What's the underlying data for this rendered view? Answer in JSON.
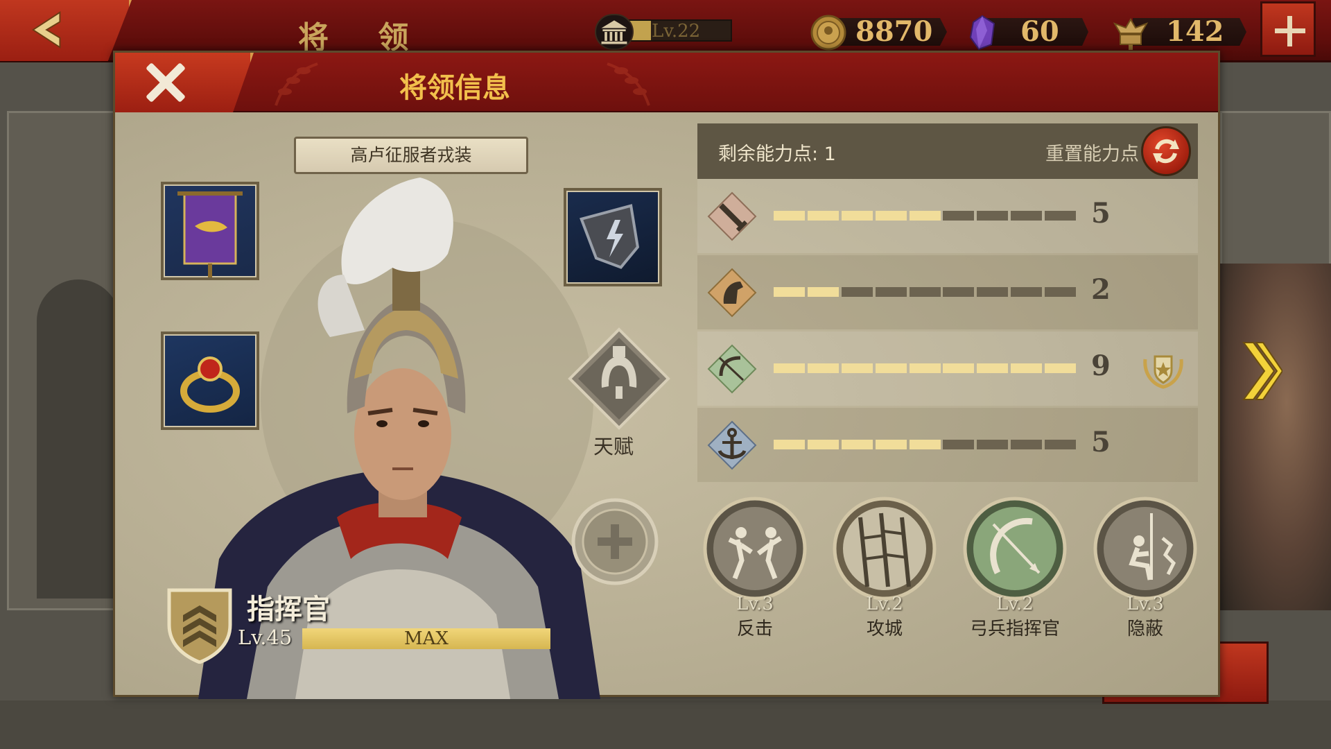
{
  "topbar": {
    "title": "将 领",
    "city_level": "Lv.22",
    "city_level_progress": 0.22,
    "resources": [
      {
        "name": "coins",
        "icon": "coin-icon",
        "value": "8870"
      },
      {
        "name": "gems",
        "icon": "gem-icon",
        "value": "60"
      },
      {
        "name": "spqr",
        "icon": "spqr-eagle-icon",
        "value": "142"
      }
    ]
  },
  "panel": {
    "title": "将领信息",
    "outfit_label": "高卢征服者戎装",
    "talent_label": "天赋",
    "rank": {
      "title": "指挥官",
      "level": "Lv.45",
      "progress_label": "MAX",
      "progress": 1.0
    }
  },
  "stats": {
    "remaining_points_label": "剩余能力点: 1",
    "reset_label": "重置能力点",
    "max_segments": 9,
    "rows": [
      {
        "icon": "sword-icon",
        "value": "5",
        "filled": 5,
        "badge": false
      },
      {
        "icon": "horse-icon",
        "value": "2",
        "filled": 2,
        "badge": false
      },
      {
        "icon": "bow-icon",
        "value": "9",
        "filled": 9,
        "badge": true
      },
      {
        "icon": "anchor-icon",
        "value": "5",
        "filled": 5,
        "badge": false
      }
    ]
  },
  "skills": [
    {
      "icon": "counterattack-icon",
      "level": "Lv.3",
      "name": "反击"
    },
    {
      "icon": "siege-ladder-icon",
      "level": "Lv.2",
      "name": "攻城"
    },
    {
      "icon": "archer-bow-icon",
      "level": "Lv.2",
      "name": "弓兵指挥官"
    },
    {
      "icon": "concealment-icon",
      "level": "Lv.3",
      "name": "隐蔽"
    }
  ],
  "colors": {
    "header_red": "#8c1813",
    "accent_gold": "#f2c04c",
    "bar_on": "#f1dd9a",
    "bar_off": "#6c6350"
  }
}
